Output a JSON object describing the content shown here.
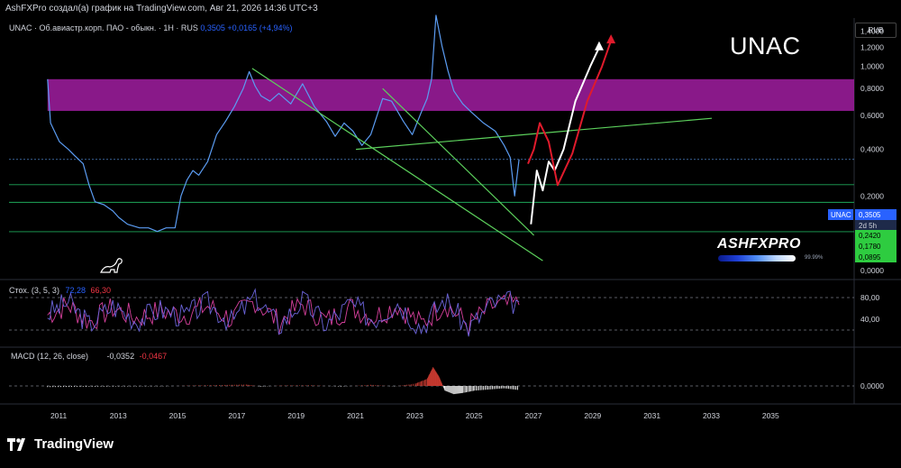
{
  "header": {
    "publisher_line": "AshFXPro создал(а) график на TradingView.com, Авг 21, 2026 14:36 UTC+3",
    "symbol_line": "UNAC · Об.авиастр.корп. ПАО - обыкн. · 1H · RUS",
    "price": "0,3505",
    "change": "+0,0165 (+4,94%)",
    "symbol_big": "UNAC",
    "currency": "RUB"
  },
  "brand": {
    "name": "ASHFXPRO",
    "progress_label": "99.99%",
    "progress": 0.9999
  },
  "footer": {
    "logo_text": "TradingView"
  },
  "colors": {
    "price_line": "#5b9cf2",
    "zone": "#9c1c9c",
    "trend_green": "#5cd05c",
    "level_green": "#1ea85a",
    "arrow_white": "#ffffff",
    "arrow_red": "#e01b2c",
    "stoch_k": "#6a63d8",
    "stoch_d": "#d6409c",
    "macd_up": "#c4392f",
    "macd_down": "#e8e8e8"
  },
  "chart_data": [
    {
      "panel": "price",
      "type": "line",
      "title": "UNAC · Об.авиастр.корп. ПАО - обыкн. · 1H · RUS",
      "x_tick_labels": [
        "2011",
        "2013",
        "2015",
        "2017",
        "2019",
        "2021",
        "2023",
        "2025",
        "2027",
        "2029",
        "2031",
        "2033",
        "2035"
      ],
      "xlim": [
        2009.3,
        2037.8
      ],
      "y_axis_scale": "log",
      "y_tick_labels": [
        "1,4000",
        "1,2000",
        "1,0000",
        "0,8000",
        "0,6000",
        "0,4000",
        "0,2000",
        "0,0000"
      ],
      "ylim": [
        0.0,
        1.58
      ],
      "series": [
        {
          "name": "UNAC",
          "x": [
            2010.6,
            2010.7,
            2011.0,
            2011.3,
            2011.5,
            2011.8,
            2012.0,
            2012.2,
            2012.5,
            2012.8,
            2013.0,
            2013.3,
            2013.7,
            2014.0,
            2014.3,
            2014.6,
            2014.9,
            2015.1,
            2015.3,
            2015.5,
            2015.7,
            2016.0,
            2016.3,
            2016.6,
            2016.9,
            2017.2,
            2017.4,
            2017.6,
            2017.8,
            2018.1,
            2018.4,
            2018.8,
            2019.2,
            2019.6,
            2020.0,
            2020.3,
            2020.6,
            2020.9,
            2021.2,
            2021.5,
            2021.9,
            2022.2,
            2022.6,
            2022.9,
            2023.2,
            2023.4,
            2023.55,
            2023.7,
            2023.9,
            2024.1,
            2024.3,
            2024.6,
            2024.9,
            2025.3,
            2025.7,
            2026.0,
            2026.2,
            2026.35,
            2026.5
          ],
          "values": [
            0.88,
            0.55,
            0.44,
            0.4,
            0.37,
            0.33,
            0.24,
            0.18,
            0.17,
            0.15,
            0.13,
            0.11,
            0.1,
            0.1,
            0.09,
            0.1,
            0.1,
            0.2,
            0.26,
            0.3,
            0.28,
            0.34,
            0.48,
            0.56,
            0.66,
            0.8,
            0.95,
            0.82,
            0.74,
            0.7,
            0.76,
            0.68,
            0.84,
            0.66,
            0.56,
            0.47,
            0.55,
            0.5,
            0.42,
            0.48,
            0.72,
            0.7,
            0.56,
            0.48,
            0.62,
            0.72,
            0.88,
            1.62,
            1.22,
            0.96,
            0.78,
            0.68,
            0.62,
            0.55,
            0.5,
            0.42,
            0.36,
            0.2,
            0.3505
          ]
        }
      ],
      "price_labels": [
        {
          "label": "UNAC",
          "value": "0,3505"
        },
        {
          "label": "",
          "value": "2d 5h"
        },
        {
          "label": "",
          "value": "0,2420"
        },
        {
          "label": "",
          "value": "0,1780"
        },
        {
          "label": "",
          "value": "0,0895"
        }
      ],
      "horizontal_levels": [
        0.242,
        0.178,
        0.0895
      ],
      "zone": {
        "y_bottom": 0.63,
        "y_top": 0.88,
        "x_start": 2010.6
      },
      "trendlines": [
        {
          "x": [
            2017.5,
            2027.3
          ],
          "y": [
            0.98,
            0.02
          ]
        },
        {
          "x": [
            2021.9,
            2027.0
          ],
          "y": [
            0.8,
            0.08
          ]
        },
        {
          "x": [
            2021.0,
            2033.0
          ],
          "y": [
            0.4,
            0.58
          ]
        }
      ],
      "forecast_paths": [
        {
          "name": "white",
          "x": [
            2026.9,
            2027.1,
            2027.3,
            2027.5,
            2027.7,
            2028.0,
            2028.4,
            2028.9,
            2029.2
          ],
          "y": [
            0.11,
            0.3,
            0.22,
            0.34,
            0.3,
            0.4,
            0.7,
            1.0,
            1.2
          ]
        },
        {
          "name": "red",
          "x": [
            2026.8,
            2027.0,
            2027.2,
            2027.5,
            2027.8,
            2028.3,
            2028.8,
            2029.3,
            2029.6
          ],
          "y": [
            0.33,
            0.4,
            0.55,
            0.44,
            0.24,
            0.38,
            0.7,
            1.0,
            1.28
          ]
        }
      ]
    },
    {
      "panel": "stochastic",
      "type": "line",
      "title": "Стох. (3, 5, 3)",
      "legend_values": [
        "72,28",
        "66,30"
      ],
      "y_tick_labels": [
        "80,00",
        "40,00"
      ],
      "ylim": [
        0,
        100
      ],
      "series": [
        {
          "name": "%K",
          "x": [
            2010.6,
            2011.3,
            2012.0,
            2012.8,
            2013.6,
            2014.4,
            2015.2,
            2016.0,
            2016.8,
            2017.6,
            2018.4,
            2019.2,
            2020.0,
            2020.8,
            2021.6,
            2022.4,
            2023.2,
            2024.0,
            2024.8,
            2025.6,
            2026.5
          ],
          "values": [
            50,
            72,
            30,
            65,
            38,
            58,
            45,
            70,
            35,
            82,
            28,
            75,
            30,
            68,
            40,
            72,
            25,
            78,
            22,
            70,
            72.28
          ]
        },
        {
          "name": "%D",
          "x": [
            2010.6,
            2011.3,
            2012.0,
            2012.8,
            2013.6,
            2014.4,
            2015.2,
            2016.0,
            2016.8,
            2017.6,
            2018.4,
            2019.2,
            2020.0,
            2020.8,
            2021.6,
            2022.4,
            2023.2,
            2024.0,
            2024.8,
            2025.6,
            2026.5
          ],
          "values": [
            48,
            66,
            35,
            60,
            42,
            55,
            48,
            64,
            40,
            74,
            34,
            68,
            36,
            62,
            44,
            66,
            30,
            70,
            28,
            64,
            66.3
          ]
        }
      ]
    },
    {
      "panel": "macd",
      "type": "bar",
      "title": "MACD (12, 26, close)",
      "legend_values": [
        "-0,0352",
        "-0,0467"
      ],
      "y_tick_labels": [
        "0,0000"
      ],
      "ylim": [
        -0.1,
        0.18
      ],
      "series": [
        {
          "name": "histogram",
          "x": [
            2010.6,
            2011.5,
            2012.5,
            2013.5,
            2014.5,
            2015.5,
            2016.5,
            2017.3,
            2017.8,
            2018.5,
            2019.5,
            2020.5,
            2021.5,
            2022.3,
            2023.0,
            2023.4,
            2023.6,
            2023.8,
            2024.0,
            2024.3,
            2024.6,
            2025.0,
            2025.5,
            2026.0,
            2026.5
          ],
          "values": [
            -0.01,
            -0.008,
            -0.006,
            -0.004,
            -0.003,
            0.004,
            0.008,
            0.012,
            -0.006,
            0.004,
            0.006,
            -0.006,
            0.01,
            -0.004,
            0.02,
            0.06,
            0.16,
            0.08,
            -0.04,
            -0.07,
            -0.06,
            -0.04,
            -0.03,
            -0.02,
            -0.0352
          ]
        }
      ]
    }
  ]
}
